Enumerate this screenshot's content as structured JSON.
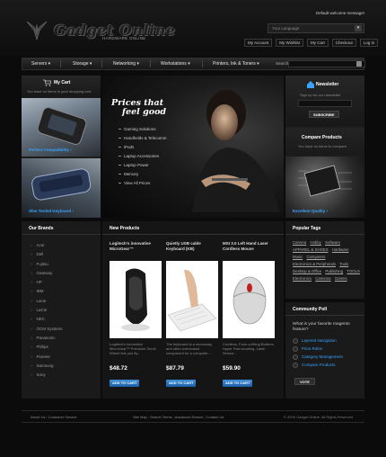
{
  "header": {
    "logo_text": "Gadget Online",
    "logo_tagline": "HARDWARE ONLINE",
    "welcome": "Default welcome message!",
    "language_select": "Your Language",
    "top_links": [
      "My Account",
      "My Wishlist",
      "My Cart",
      "Checkout",
      "Log In"
    ]
  },
  "nav": {
    "items": [
      "Servers",
      "Storage",
      "Networking",
      "Workstations",
      "Printers, Ink & Toners"
    ],
    "search_label": "Search:"
  },
  "cart": {
    "title": "My Cart",
    "empty_text": "You have no items in your shopping cart."
  },
  "promo": {
    "items": [
      {
        "label": "Perfect Compatibility"
      },
      {
        "label": "Slim Tooled Keyboard"
      }
    ]
  },
  "hero": {
    "title_line1": "Prices that",
    "title_line2": "feel good",
    "links": [
      "Gaming Solutions",
      "Handhelds & Telecomm",
      "iPods",
      "Laptop Accessories",
      "Laptop Power",
      "Memory",
      "View All Prices"
    ]
  },
  "newsletter": {
    "title": "Newsletter",
    "text": "Sign up for our newsletter",
    "button": "SUBSCRIBE"
  },
  "compare": {
    "title": "Compare Products",
    "text": "You have no items to compare.",
    "caption": "Excellent Quality"
  },
  "brands": {
    "title": "Our Brands",
    "items": [
      "Acer",
      "Dell",
      "Fujitsu",
      "Gateway",
      "HP",
      "IBM",
      "Lacie",
      "LaCie",
      "NEC",
      "OCM Systems",
      "Panasonic",
      "Philips",
      "Pioneer",
      "Samsung",
      "Sony"
    ]
  },
  "new_products": {
    "title": "New Products",
    "items": [
      {
        "name": "Logitech's innovative MicroGear™",
        "desc": "Logitech's innovative MicroGear™ Precision Scroll Wheel lets you fly...",
        "price": "$48.72",
        "button": "ADD TO CART"
      },
      {
        "name": "Quietly USB cable Keyboard (KB)",
        "desc": "The keyboard is a necessary and often overlooked component for a computer...",
        "price": "$87.79",
        "button": "ADD TO CART"
      },
      {
        "name": "MSI 3.0 Left Hand Laser Cordless Mouse",
        "desc": "Cordless, Form-a-fitting Buttons, Hyper Fast scrolling, Laser Sensor...",
        "price": "$59.90",
        "button": "ADD TO CART"
      }
    ]
  },
  "tags": {
    "title": "Popular Tags",
    "items": [
      "Camera",
      "Hobby",
      "Software",
      "APPAREL & SHOES",
      "Hardware",
      "Music",
      "Computers",
      "Electronics & Peripherals",
      "Tools",
      "Desktop & Office",
      "Publishing",
      "TOOLS",
      "Electronics",
      "Cameras",
      "Games"
    ]
  },
  "poll": {
    "title": "Community Poll",
    "question": "What is your favorite magento feature?",
    "options": [
      "Layered Navigation",
      "Price Rules",
      "Category Management",
      "Compare Products"
    ],
    "button": "VOTE"
  },
  "footer": {
    "left_links": [
      "About Us",
      "Customer Service"
    ],
    "right_links": [
      "Site Map",
      "Search Terms",
      "Advanced Search",
      "Contact Us"
    ],
    "copyright": "© 2009 Gadget Online. All Rights Reserved"
  },
  "colors": {
    "accent": "#3aa3ff",
    "background": "#0b0b0b",
    "panel": "#1c1c1c"
  }
}
